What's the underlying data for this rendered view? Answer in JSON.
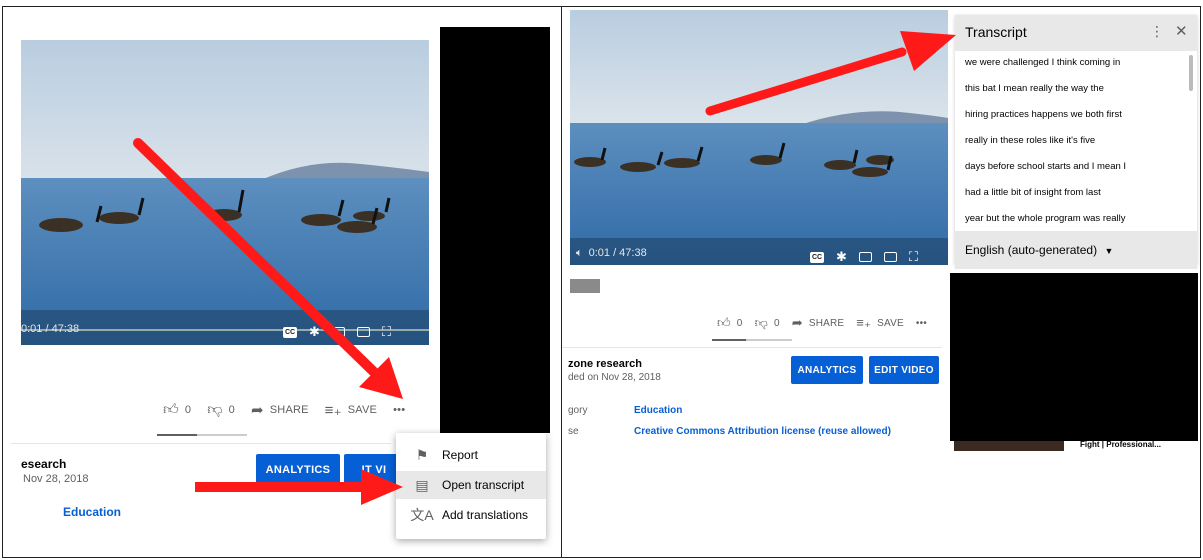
{
  "left": {
    "video": {
      "time": "0:01 / 47:38"
    },
    "actions": {
      "likes": "0",
      "dislikes": "0",
      "share": "SHARE",
      "save": "SAVE",
      "more": "•••"
    },
    "channel": {
      "name": "esearch",
      "date": "Nov 28, 2018"
    },
    "buttons": {
      "analytics": "ANALYTICS",
      "edit": "IT VI"
    },
    "category": "Education",
    "menu": {
      "report": "Report",
      "open_transcript": "Open transcript",
      "add_translations": "Add translations"
    }
  },
  "right": {
    "video": {
      "time": "0:01 / 47:38"
    },
    "actions": {
      "likes": "0",
      "dislikes": "0",
      "share": "SHARE",
      "save": "SAVE",
      "more": "•••"
    },
    "channel": {
      "name": "zone research",
      "date": "ded on Nov 28, 2018"
    },
    "buttons": {
      "analytics": "ANALYTICS",
      "edit": "EDIT VIDEO"
    },
    "meta": [
      {
        "label": "gory",
        "value": "Education"
      },
      {
        "label": "se",
        "value": "Creative Commons Attribution license (reuse allowed)"
      }
    ],
    "transcript": {
      "title": "Transcript",
      "lines": [
        "we were challenged I think coming in",
        "this bat I mean really the way the",
        "hiring practices happens we both first",
        "really in these roles like it's five",
        "days before school starts and I mean I",
        "had a little bit of insight from last",
        "year but the whole program was really"
      ],
      "language": "English (auto-generated)"
    },
    "suggested_title": "Fight | Professional..."
  },
  "colors": {
    "accent": "#065fd4",
    "arrow": "#ff1a1a"
  }
}
